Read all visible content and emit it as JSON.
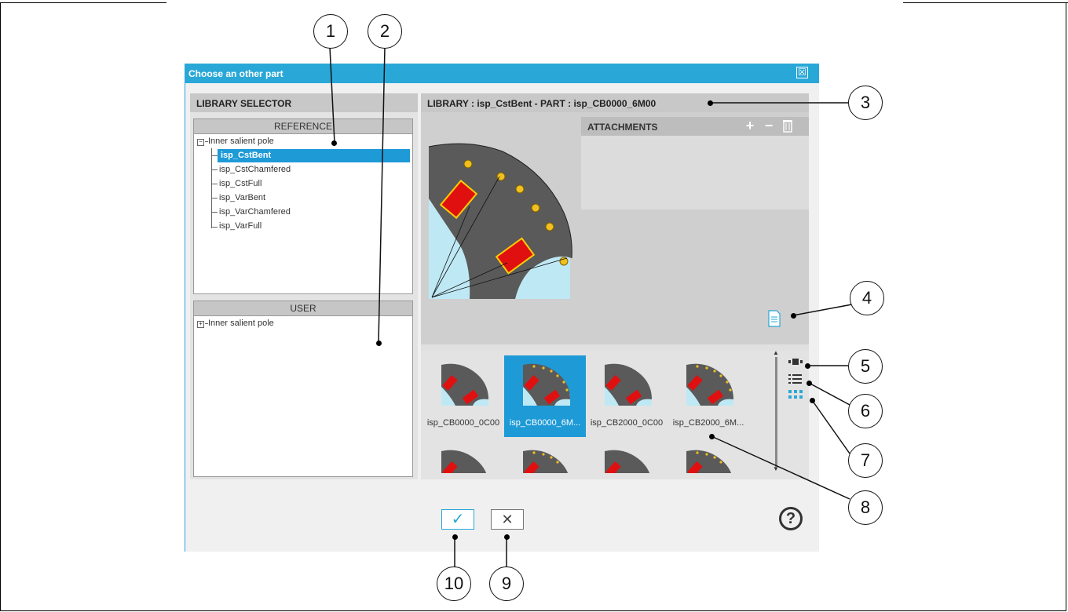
{
  "dialog": {
    "title": "Choose an other part",
    "close_symbol": "☒"
  },
  "library_selector": {
    "title": "LIBRARY SELECTOR",
    "reference": {
      "header": "REFERENCE",
      "root": "Inner salient pole",
      "items": [
        "isp_CstBent",
        "isp_CstChamfered",
        "isp_CstFull",
        "isp_VarBent",
        "isp_VarChamfered",
        "isp_VarFull"
      ],
      "selected": "isp_CstBent"
    },
    "user": {
      "header": "USER",
      "root": "Inner salient pole"
    }
  },
  "library_header": "LIBRARY : isp_CstBent   -   PART : isp_CB0000_6M00",
  "attachments": {
    "title": "ATTACHMENTS",
    "add": "+",
    "remove": "−",
    "delete_icon": "trash-icon"
  },
  "gallery": {
    "items": [
      {
        "label": "isp_CB0000_0C00",
        "magnets": false
      },
      {
        "label": "isp_CB0000_6M...",
        "magnets": true,
        "selected": true
      },
      {
        "label": "isp_CB2000_0C00",
        "magnets": false
      },
      {
        "label": "isp_CB2000_6M...",
        "magnets": true
      }
    ]
  },
  "buttons": {
    "ok": "✓",
    "cancel": "✕",
    "help": "?"
  },
  "callouts": [
    "1",
    "2",
    "3",
    "4",
    "5",
    "6",
    "7",
    "8",
    "9",
    "10"
  ],
  "colors": {
    "accent": "#29a8d8",
    "selection": "#1e9ad6",
    "slot_red": "#e01010",
    "stator_gray": "#5a5a5a",
    "air_blue": "#bfe8f5"
  }
}
